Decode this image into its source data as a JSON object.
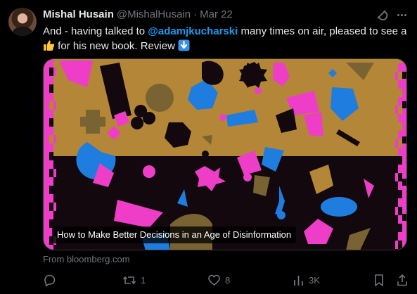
{
  "author": {
    "name": "Mishal Husain",
    "handle": "@MishalHusain",
    "separator": "·",
    "date": "Mar 22"
  },
  "tweet": {
    "text_part1": "And - having talked to ",
    "mention": "@adamjkucharski",
    "text_part2": " many times on air, pleased to see a ",
    "text_part3": " for his new book. Review ",
    "emoji_1": "thumbs-up",
    "emoji_2": "down-arrow-button"
  },
  "card": {
    "caption": "How to Make Better Decisions in an Age of Disinformation",
    "source": "From bloomberg.com",
    "colors": {
      "mustard": "#b48637",
      "black": "#12080e",
      "magenta": "#ee3ec8",
      "blue": "#1f7de0"
    }
  },
  "actions": {
    "reply": {
      "icon": "reply-icon",
      "count": ""
    },
    "repost": {
      "icon": "repost-icon",
      "count": "1"
    },
    "like": {
      "icon": "heart-icon",
      "count": "8"
    },
    "views": {
      "icon": "views-icon",
      "count": "3K"
    },
    "bookmark": {
      "icon": "bookmark-icon"
    },
    "share": {
      "icon": "share-icon"
    }
  },
  "header_icons": {
    "grok": "grok-icon",
    "more": "more-icon"
  }
}
